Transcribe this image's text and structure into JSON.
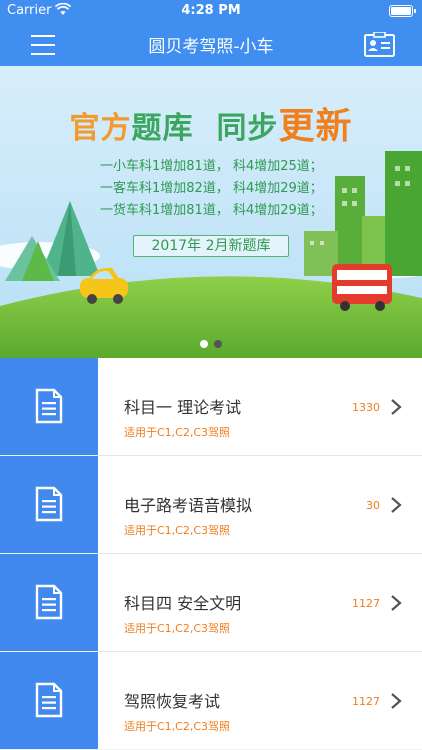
{
  "status_bar": {
    "carrier": "Carrier",
    "time": "4:28 PM"
  },
  "nav": {
    "title": "圆贝考驾照-小车",
    "left_icon": "menu-icon",
    "right_icon": "id-card-icon"
  },
  "banner": {
    "headline_part1": "官方",
    "headline_part2": "题库",
    "headline_part3": "同步",
    "headline_part4": "更新",
    "updates": [
      "一小车科1增加81道， 科4增加25道；",
      "一客车科1增加82道， 科4增加29道；",
      "一货车科1增加81道， 科4增加29道；"
    ],
    "date_label": "2017年 2月新题库",
    "page_count": 2,
    "active_page": 1
  },
  "subjects": [
    {
      "title": "科目一 理论考试",
      "subtitle": "适用于C1,C2,C3驾照",
      "count": "1330"
    },
    {
      "title": "电子路考语音模拟",
      "subtitle": "适用于C1,C2,C3驾照",
      "count": "30"
    },
    {
      "title": "科目四 安全文明",
      "subtitle": "适用于C1,C2,C3驾照",
      "count": "1127"
    },
    {
      "title": "驾照恢复考试",
      "subtitle": "适用于C1,C2,C3驾照",
      "count": "1127"
    }
  ],
  "colors": {
    "primary": "#3f8ef0",
    "icon_tile": "#4189ee",
    "accent_orange": "#f07e1e",
    "green": "#3aa660"
  }
}
